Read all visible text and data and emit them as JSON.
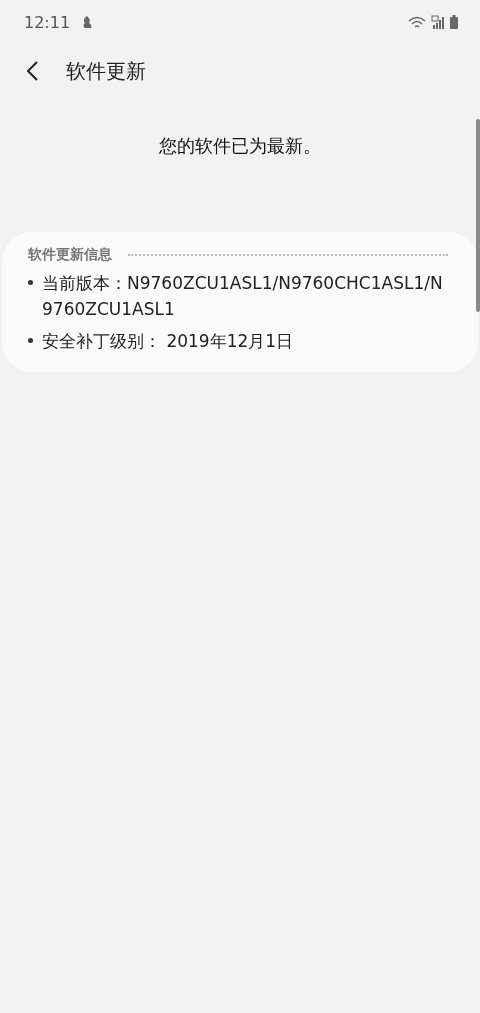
{
  "status_bar": {
    "time": "12:11"
  },
  "header": {
    "title": "软件更新"
  },
  "message": "您的软件已为最新。",
  "info_card": {
    "title": "软件更新信息",
    "items": [
      {
        "text": "当前版本：N9760ZCU1ASL1/N9760CHC1ASL1/N9760ZCU1ASL1"
      },
      {
        "text": "安全补丁级别： 2019年12月1日"
      }
    ]
  }
}
